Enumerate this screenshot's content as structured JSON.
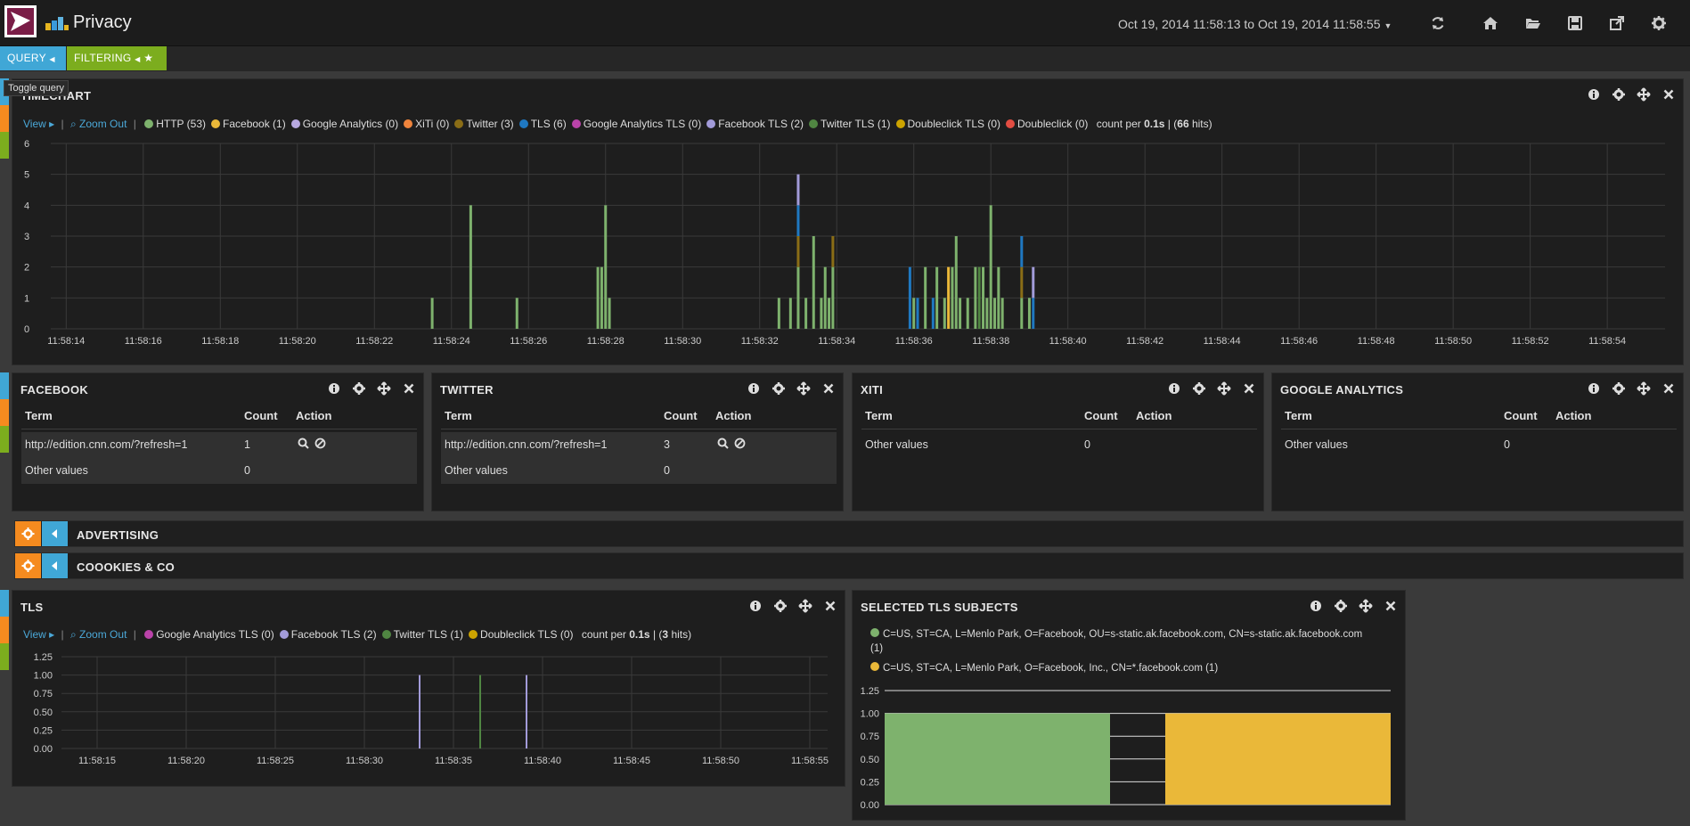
{
  "app": {
    "title": "Privacy"
  },
  "header": {
    "time_range": "Oct 19, 2014 11:58:13 to Oct 19, 2014 11:58:55",
    "icons": [
      "refresh-icon",
      "home-icon",
      "folder-open-icon",
      "save-icon",
      "share-icon",
      "gear-icon"
    ]
  },
  "pills": {
    "query": "QUERY",
    "filtering": "FILTERING"
  },
  "tooltip": "Toggle query",
  "colors": {
    "query": "#40a7d6",
    "filtering": "#7cad1e",
    "gear": "#f58b1f",
    "http": "#7eb26d",
    "facebook": "#eab839",
    "google_analytics": "#b7a8e0",
    "xiti": "#ef843c",
    "twitter": "#8a6d16",
    "tls": "#1f78c1",
    "google_analytics_tls": "#ba43a9",
    "facebook_tls": "#a29bd9",
    "twitter_tls": "#508642",
    "doubleclick_tls": "#cca300",
    "doubleclick": "#e24d42"
  },
  "timechart": {
    "title": "TIMECHART",
    "view": "View",
    "zoom_out": "Zoom Out",
    "legend": [
      {
        "label": "HTTP (53)",
        "color": "#7eb26d"
      },
      {
        "label": "Facebook (1)",
        "color": "#eab839"
      },
      {
        "label": "Google Analytics (0)",
        "color": "#b7a8e0"
      },
      {
        "label": "XiTi (0)",
        "color": "#ef843c"
      },
      {
        "label": "Twitter (3)",
        "color": "#8a6d16"
      },
      {
        "label": "TLS (6)",
        "color": "#1f78c1"
      },
      {
        "label": "Google Analytics TLS (0)",
        "color": "#ba43a9"
      },
      {
        "label": "Facebook TLS (2)",
        "color": "#a29bd9"
      },
      {
        "label": "Twitter TLS (1)",
        "color": "#508642"
      },
      {
        "label": "Doubleclick TLS (0)",
        "color": "#cca300"
      },
      {
        "label": "Doubleclick (0)",
        "color": "#e24d42"
      }
    ],
    "count_prefix": "count per",
    "interval": "0.1s",
    "hits_prefix": "|",
    "hits": "66",
    "hits_suffix": "hits"
  },
  "tls_panel": {
    "title": "TLS",
    "view": "View",
    "zoom_out": "Zoom Out",
    "legend": [
      {
        "label": "Google Analytics TLS (0)",
        "color": "#ba43a9"
      },
      {
        "label": "Facebook TLS (2)",
        "color": "#a29bd9"
      },
      {
        "label": "Twitter TLS (1)",
        "color": "#508642"
      },
      {
        "label": "Doubleclick TLS (0)",
        "color": "#cca300"
      }
    ],
    "count_prefix": "count per",
    "interval": "0.1s",
    "hits_prefix": "|",
    "hits": "3",
    "hits_suffix": "hits"
  },
  "term_panels": [
    {
      "title": "FACEBOOK",
      "headers": [
        "Term",
        "Count",
        "Action"
      ],
      "rows": [
        [
          "http://edition.cnn.com/?refresh=1",
          "1"
        ],
        [
          "Other values",
          "0"
        ]
      ]
    },
    {
      "title": "TWITTER",
      "headers": [
        "Term",
        "Count",
        "Action"
      ],
      "rows": [
        [
          "http://edition.cnn.com/?refresh=1",
          "3"
        ],
        [
          "Other values",
          "0"
        ]
      ]
    },
    {
      "title": "XITI",
      "headers": [
        "Term",
        "Count",
        "Action"
      ],
      "rows": [
        [
          "Other values",
          "0"
        ]
      ]
    },
    {
      "title": "GOOGLE ANALYTICS",
      "headers": [
        "Term",
        "Count",
        "Action"
      ],
      "rows": [
        [
          "Other values",
          "0"
        ]
      ]
    }
  ],
  "sections": [
    {
      "label": "ADVERTISING"
    },
    {
      "label": "COOOKIES & CO"
    }
  ],
  "tls_subjects": {
    "title": "SELECTED TLS SUBJECTS",
    "legend": [
      {
        "label": "C=US, ST=CA, L=Menlo Park, O=Facebook, OU=s-static.ak.facebook.com, CN=s-static.ak.facebook.com",
        "count": "(1)",
        "color": "#7eb26d"
      },
      {
        "label": "C=US, ST=CA, L=Menlo Park, O=Facebook, Inc., CN=*.facebook.com (1)",
        "count": "",
        "color": "#eab839"
      }
    ]
  },
  "chart_data": [
    {
      "type": "bar",
      "title": "TIMECHART",
      "ylim": [
        0,
        6
      ],
      "yticks": [
        "0",
        "1",
        "2",
        "3",
        "4",
        "5",
        "6"
      ],
      "xtick_labels": [
        "11:58:14",
        "11:58:16",
        "11:58:18",
        "11:58:20",
        "11:58:22",
        "11:58:24",
        "11:58:26",
        "11:58:28",
        "11:58:30",
        "11:58:32",
        "11:58:34",
        "11:58:36",
        "11:58:38",
        "11:58:40",
        "11:58:42",
        "11:58:44",
        "11:58:46",
        "11:58:48",
        "11:58:50",
        "11:58:52",
        "11:58:54"
      ],
      "xtick_seconds": [
        14,
        16,
        18,
        20,
        22,
        24,
        26,
        28,
        30,
        32,
        34,
        36,
        38,
        40,
        42,
        44,
        46,
        48,
        50,
        52,
        54
      ],
      "x_range_seconds": [
        13.6,
        55.5
      ],
      "x_unit": "seconds after 11:58:00",
      "bars": [
        {
          "t": 23.5,
          "series": "HTTP",
          "value": 1
        },
        {
          "t": 24.5,
          "series": "HTTP",
          "value": 4
        },
        {
          "t": 25.7,
          "series": "HTTP",
          "value": 1
        },
        {
          "t": 27.8,
          "series": "HTTP",
          "value": 2
        },
        {
          "t": 27.9,
          "series": "HTTP",
          "value": 2
        },
        {
          "t": 28.0,
          "series": "HTTP",
          "value": 4
        },
        {
          "t": 28.1,
          "series": "HTTP",
          "value": 1
        },
        {
          "t": 32.5,
          "series": "HTTP",
          "value": 1
        },
        {
          "t": 32.8,
          "series": "HTTP",
          "value": 1
        },
        {
          "t": 33.0,
          "series": "HTTP",
          "value": 2,
          "stack": [
            {
              "series": "Twitter",
              "value": 1
            },
            {
              "series": "TLS",
              "value": 1
            },
            {
              "series": "Facebook TLS",
              "value": 1
            }
          ]
        },
        {
          "t": 33.2,
          "series": "HTTP",
          "value": 1
        },
        {
          "t": 33.4,
          "series": "HTTP",
          "value": 3
        },
        {
          "t": 33.6,
          "series": "HTTP",
          "value": 1
        },
        {
          "t": 33.7,
          "series": "HTTP",
          "value": 2
        },
        {
          "t": 33.8,
          "series": "HTTP",
          "value": 1
        },
        {
          "t": 33.9,
          "series": "HTTP",
          "value": 2,
          "stack": [
            {
              "series": "Twitter",
              "value": 1
            }
          ]
        },
        {
          "t": 35.9,
          "series": "TLS",
          "value": 2
        },
        {
          "t": 36.0,
          "series": "HTTP",
          "value": 1
        },
        {
          "t": 36.1,
          "series": "TLS",
          "value": 1
        },
        {
          "t": 36.3,
          "series": "HTTP",
          "value": 2
        },
        {
          "t": 36.5,
          "series": "TLS",
          "value": 1
        },
        {
          "t": 36.6,
          "series": "HTTP",
          "value": 2
        },
        {
          "t": 36.8,
          "series": "HTTP",
          "value": 1
        },
        {
          "t": 36.9,
          "series": "Facebook",
          "value": 2
        },
        {
          "t": 37.0,
          "series": "HTTP",
          "value": 2
        },
        {
          "t": 37.1,
          "series": "HTTP",
          "value": 3
        },
        {
          "t": 37.2,
          "series": "HTTP",
          "value": 1
        },
        {
          "t": 37.4,
          "series": "HTTP",
          "value": 1
        },
        {
          "t": 37.6,
          "series": "HTTP",
          "value": 2
        },
        {
          "t": 37.7,
          "series": "Twitter TLS",
          "value": 2
        },
        {
          "t": 37.8,
          "series": "HTTP",
          "value": 2
        },
        {
          "t": 37.9,
          "series": "HTTP",
          "value": 1
        },
        {
          "t": 38.0,
          "series": "HTTP",
          "value": 4
        },
        {
          "t": 38.1,
          "series": "HTTP",
          "value": 1
        },
        {
          "t": 38.2,
          "series": "HTTP",
          "value": 2
        },
        {
          "t": 38.3,
          "series": "HTTP",
          "value": 1
        },
        {
          "t": 38.8,
          "series": "HTTP",
          "value": 1,
          "stack": [
            {
              "series": "Twitter",
              "value": 1
            },
            {
              "series": "TLS",
              "value": 1
            }
          ]
        },
        {
          "t": 39.0,
          "series": "HTTP",
          "value": 1
        },
        {
          "t": 39.1,
          "series": "TLS",
          "value": 1,
          "stack": [
            {
              "series": "Facebook TLS",
              "value": 1
            }
          ]
        }
      ]
    },
    {
      "type": "bar",
      "title": "TLS",
      "ylim": [
        0,
        1.25
      ],
      "yticks": [
        "0.00",
        "0.25",
        "0.50",
        "0.75",
        "1.00",
        "1.25"
      ],
      "xtick_labels": [
        "11:58:15",
        "11:58:20",
        "11:58:25",
        "11:58:30",
        "11:58:35",
        "11:58:40",
        "11:58:45",
        "11:58:50",
        "11:58:55"
      ],
      "xtick_seconds": [
        15,
        20,
        25,
        30,
        35,
        40,
        45,
        50,
        55
      ],
      "x_range_seconds": [
        13.0,
        56.0
      ],
      "x_unit": "seconds after 11:58:00",
      "bars": [
        {
          "t": 33.1,
          "series": "Facebook TLS",
          "value": 1
        },
        {
          "t": 36.5,
          "series": "Twitter TLS",
          "value": 1
        },
        {
          "t": 39.1,
          "series": "Facebook TLS",
          "value": 1
        }
      ]
    },
    {
      "type": "bar",
      "title": "SELECTED TLS SUBJECTS",
      "ylim": [
        0,
        1.25
      ],
      "yticks": [
        "0.00",
        "0.25",
        "0.50",
        "0.75",
        "1.00",
        "1.25"
      ],
      "categories": [
        "C=US, ST=CA, L=Menlo Park, O=Facebook, OU=s-static.ak.facebook.com, CN=s-static.ak.facebook.com",
        "C=US, ST=CA, L=Menlo Park, O=Facebook, Inc., CN=*.facebook.com"
      ],
      "values": [
        1,
        1
      ]
    }
  ]
}
